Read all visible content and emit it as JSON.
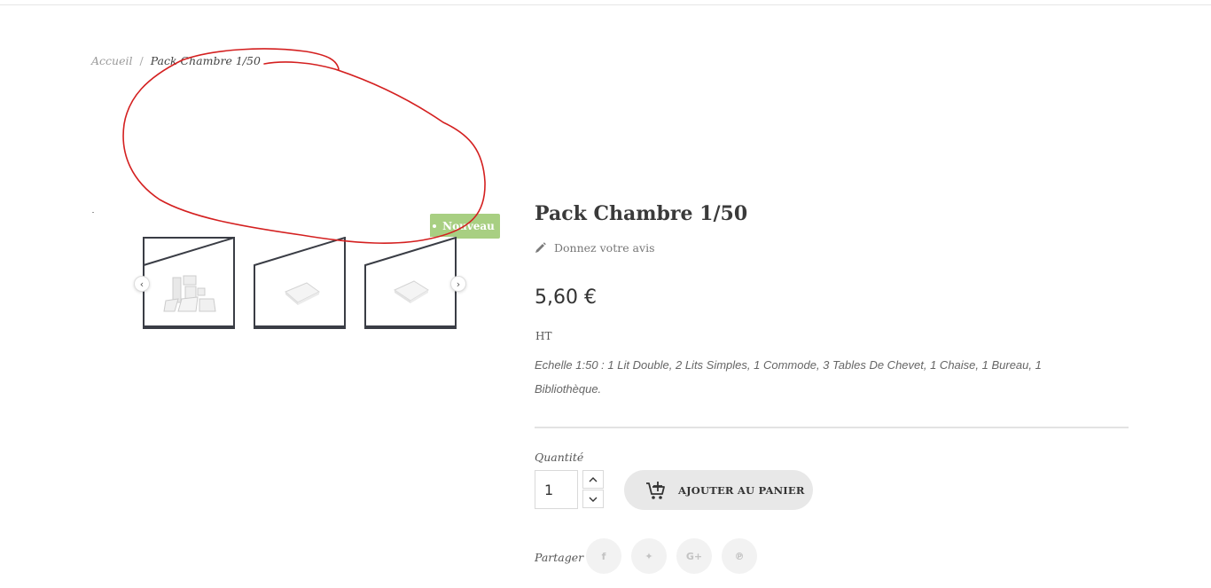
{
  "breadcrumb": {
    "home": "Accueil",
    "separator": "/",
    "current": "Pack Chambre 1/50"
  },
  "badge": {
    "label": "Nouveau"
  },
  "gallery": {
    "thumbnails": [
      {
        "alt": "furniture set"
      },
      {
        "alt": "white block"
      },
      {
        "alt": "white block"
      }
    ],
    "prev_glyph": "‹",
    "next_glyph": "›"
  },
  "product": {
    "title": "Pack Chambre 1/50",
    "review_link": "Donnez votre avis",
    "price": "5,60 €",
    "tax": "HT",
    "description": "Echelle 1:50 : 1 Lit Double, 2 Lits Simples, 1 Commode, 3 Tables De Chevet, 1 Chaise, 1 Bureau, 1 Bibliothèque."
  },
  "cart": {
    "quantity_label": "Quantité",
    "quantity_value": "1",
    "add_to_cart_label": "AJOUTER AU PANIER"
  },
  "share": {
    "label": "Partager",
    "buttons": [
      {
        "name": "facebook",
        "glyph": "f"
      },
      {
        "name": "twitter",
        "glyph": "✦"
      },
      {
        "name": "google-plus",
        "glyph": "G+"
      },
      {
        "name": "pinterest",
        "glyph": "℗"
      }
    ]
  },
  "colors": {
    "badge": "#a8cf82",
    "annotation": "#d42020",
    "button_bg": "#e8e8e8"
  }
}
